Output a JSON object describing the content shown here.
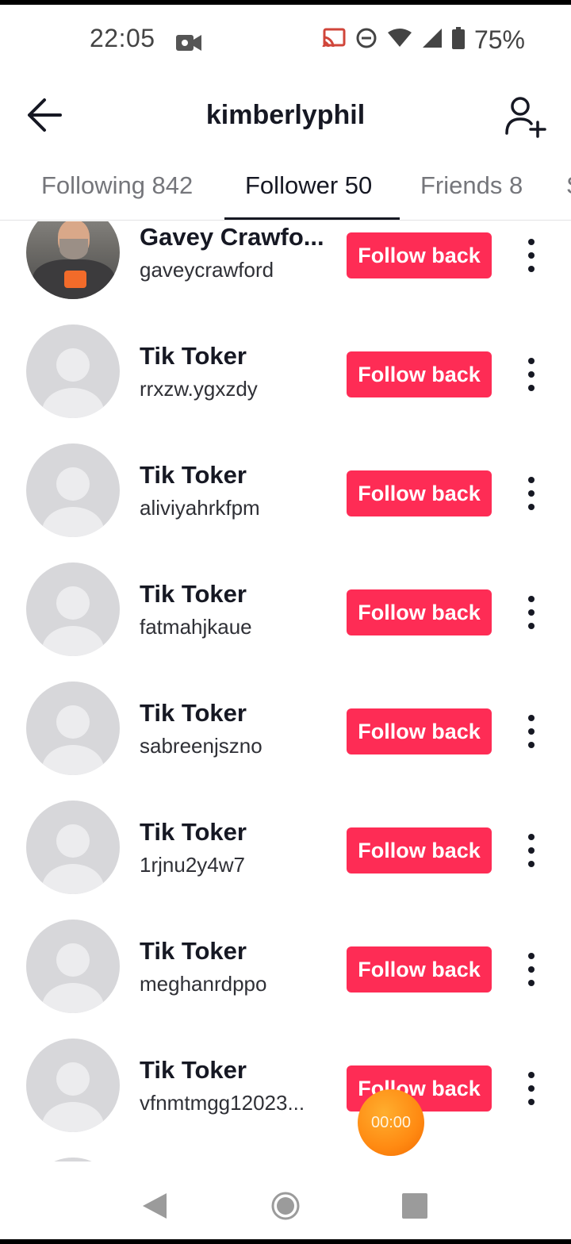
{
  "status_bar": {
    "time": "22:05",
    "battery": "75%"
  },
  "header": {
    "title": "kimberlyphil"
  },
  "tabs": [
    {
      "label": "Following 842",
      "active": false
    },
    {
      "label": "Follower 50",
      "active": true
    },
    {
      "label": "Friends 8",
      "active": false
    },
    {
      "label": "S",
      "active": false
    }
  ],
  "followers": [
    {
      "name": "Gavey Crawfo...",
      "handle": "gaveycrawford",
      "button": "Follow back",
      "avatar": "photo"
    },
    {
      "name": "Tik Toker",
      "handle": "rrxzw.ygxzdy",
      "button": "Follow back",
      "avatar": "default"
    },
    {
      "name": "Tik Toker",
      "handle": "aliviyahrkfpm",
      "button": "Follow back",
      "avatar": "default"
    },
    {
      "name": "Tik Toker",
      "handle": "fatmahjkaue",
      "button": "Follow back",
      "avatar": "default"
    },
    {
      "name": "Tik Toker",
      "handle": "sabreenjszno",
      "button": "Follow back",
      "avatar": "default"
    },
    {
      "name": "Tik Toker",
      "handle": "1rjnu2y4w7",
      "button": "Follow back",
      "avatar": "default"
    },
    {
      "name": "Tik Toker",
      "handle": "meghanrdppo",
      "button": "Follow back",
      "avatar": "default"
    },
    {
      "name": "Tik Toker",
      "handle": "vfnmtmgg12023...",
      "button": "Follow back",
      "avatar": "default"
    }
  ],
  "timer": {
    "label": "00:00"
  },
  "colors": {
    "accent": "#fe2c55",
    "timer": "#ff8a12",
    "text_primary": "#161823",
    "text_secondary": "#75767b"
  },
  "icons": {
    "back": "arrow-left-icon",
    "add_user": "person-plus-icon",
    "more": "vertical-dots-icon",
    "nav": [
      "triangle-back-icon",
      "circle-home-icon",
      "square-recents-icon"
    ]
  }
}
